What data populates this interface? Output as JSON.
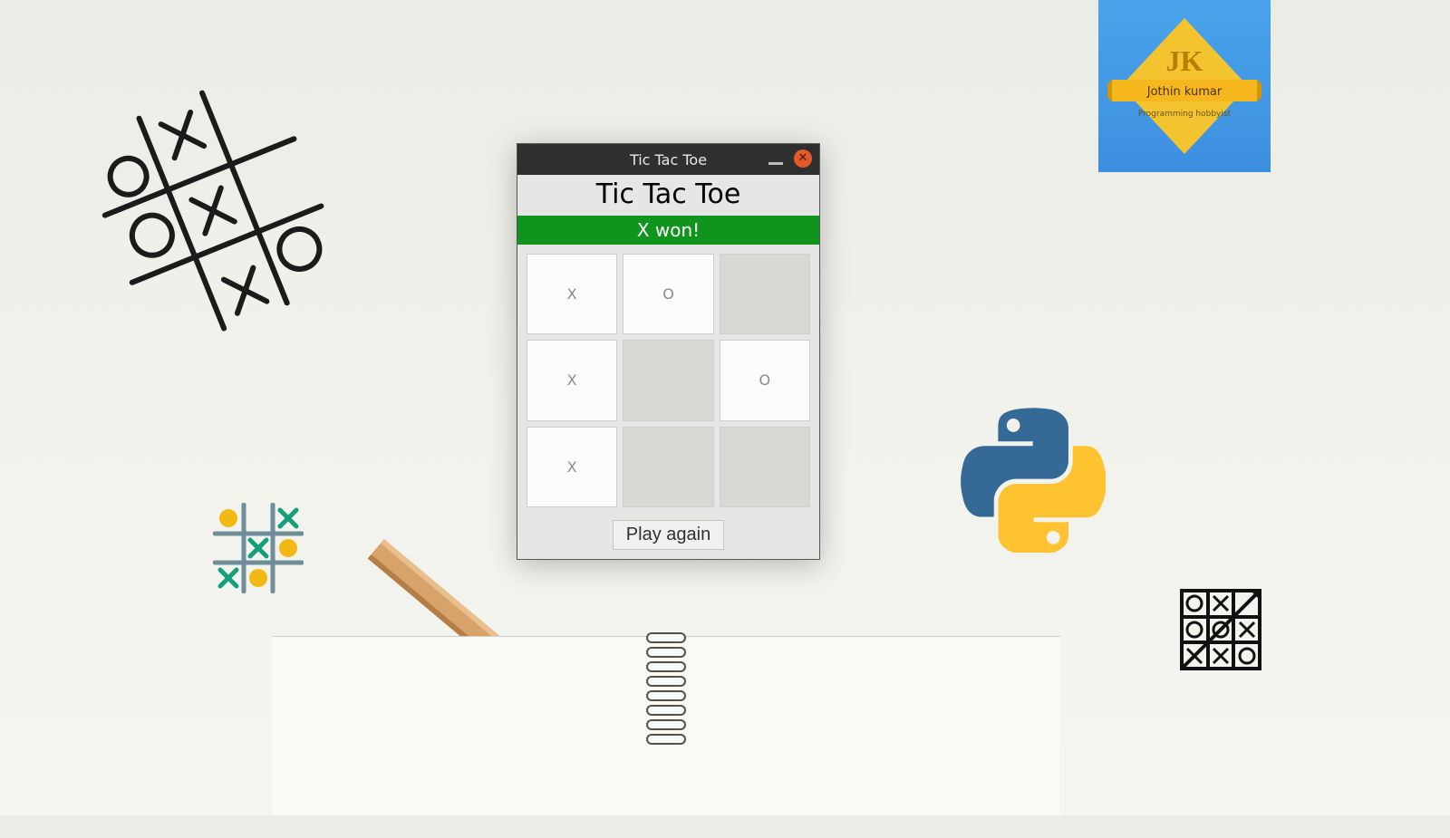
{
  "window": {
    "titlebar_title": "Tic Tac Toe",
    "app_title": "Tic Tac Toe",
    "status": "X won!",
    "play_again_label": "Play again",
    "board": [
      {
        "value": "X",
        "filled": true
      },
      {
        "value": "O",
        "filled": true
      },
      {
        "value": "",
        "filled": false
      },
      {
        "value": "X",
        "filled": true
      },
      {
        "value": "",
        "filled": false
      },
      {
        "value": "O",
        "filled": true
      },
      {
        "value": "X",
        "filled": true
      },
      {
        "value": "",
        "filled": false
      },
      {
        "value": "",
        "filled": false
      }
    ]
  },
  "badge": {
    "initials": "JK",
    "name": "Jothin kumar",
    "subtitle": "Programming hobbyist"
  },
  "colors": {
    "status_green": "#11941d",
    "close_orange": "#e15a28",
    "python_blue": "#366a96",
    "python_yellow": "#ffc331",
    "badge_bg": "#3d8fe0",
    "badge_diamond": "#f4c430"
  }
}
